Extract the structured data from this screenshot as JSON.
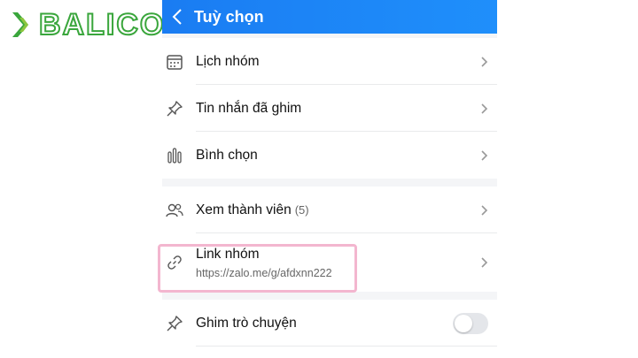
{
  "brand": {
    "name": "BALICO",
    "color": "#3aa63c"
  },
  "header": {
    "title": "Tuỳ chọn",
    "back_icon": "chevron-left-icon",
    "color": "#1a7cf2"
  },
  "items": [
    {
      "icon": "calendar-icon",
      "label": "Lịch nhóm"
    },
    {
      "icon": "pin-icon",
      "label": "Tin nhắn đã ghim"
    },
    {
      "icon": "poll-icon",
      "label": "Bình chọn"
    }
  ],
  "members": {
    "icon": "users-icon",
    "label": "Xem thành viên",
    "count": "(5)"
  },
  "group_link": {
    "icon": "link-icon",
    "label": "Link nhóm",
    "url": "https://zalo.me/g/afdxnn222"
  },
  "pin_chat": {
    "icon": "pin-icon",
    "label": "Ghim trò chuyện",
    "toggle": false
  }
}
